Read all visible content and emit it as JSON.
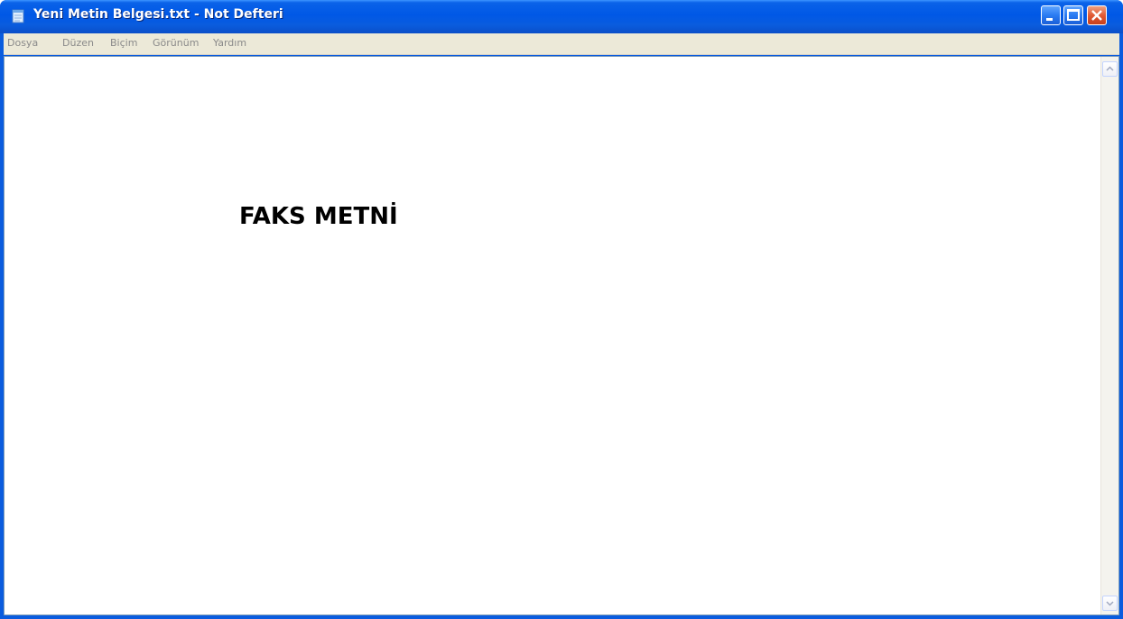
{
  "window": {
    "title": "Yeni Metin Belgesi.txt - Not Defteri",
    "accent_color": "#0a5cde",
    "icons": [
      "notepad-icon",
      "minimize-icon",
      "maximize-icon",
      "close-icon"
    ]
  },
  "menubar": {
    "items": [
      {
        "label": "Dosya"
      },
      {
        "label": "Düzen"
      },
      {
        "label": "Biçim"
      },
      {
        "label": "Görünüm"
      },
      {
        "label": "Yardım"
      }
    ]
  },
  "editor": {
    "content": "FAKS METNİ"
  },
  "scrollbar": {
    "icons": [
      "scroll-up-arrow-icon",
      "scroll-down-arrow-icon"
    ]
  }
}
